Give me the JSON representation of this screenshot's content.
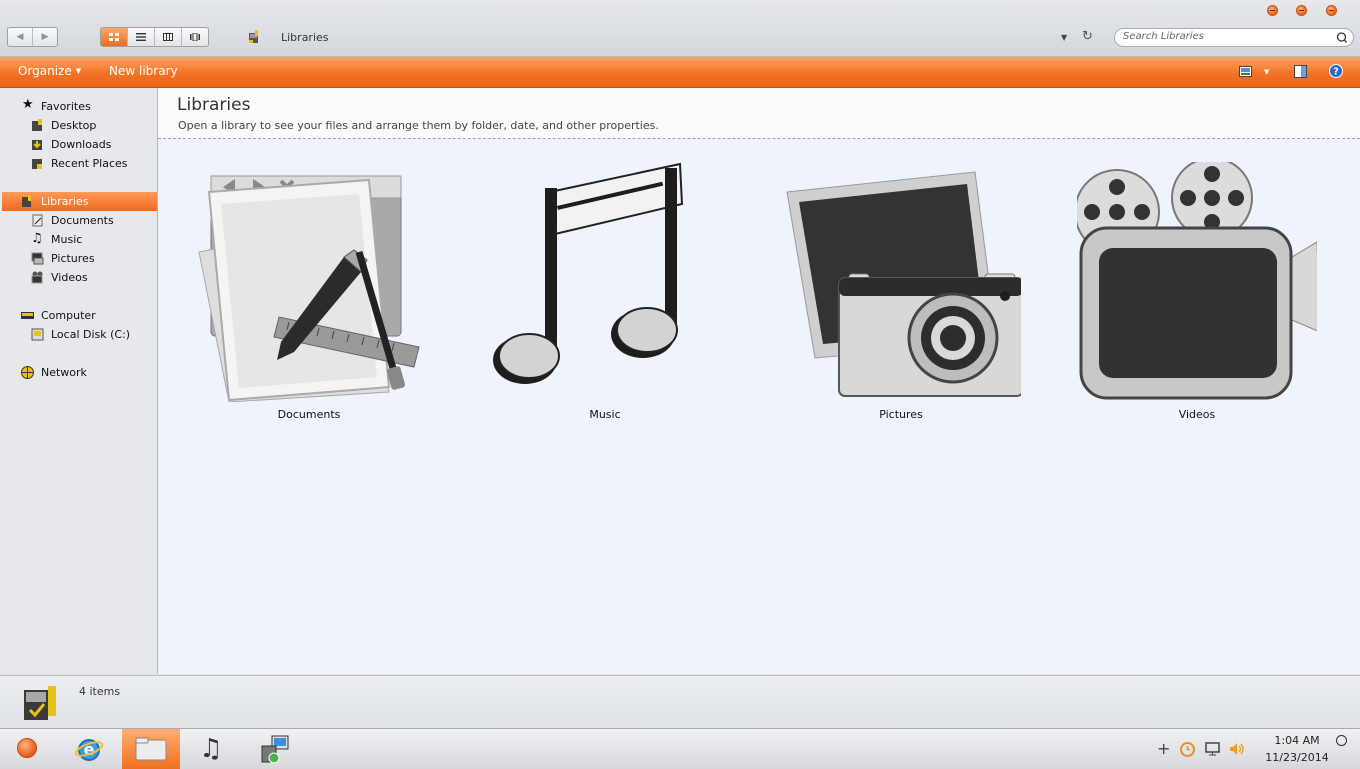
{
  "window": {
    "address_path": "Libraries",
    "search_placeholder": "Search Libraries"
  },
  "toolbar": {
    "organize_label": "Organize",
    "new_library_label": "New library"
  },
  "sidebar": {
    "favorites": {
      "label": "Favorites",
      "items": [
        {
          "label": "Desktop"
        },
        {
          "label": "Downloads"
        },
        {
          "label": "Recent Places"
        }
      ]
    },
    "libraries": {
      "label": "Libraries",
      "items": [
        {
          "label": "Documents"
        },
        {
          "label": "Music"
        },
        {
          "label": "Pictures"
        },
        {
          "label": "Videos"
        }
      ]
    },
    "computer": {
      "label": "Computer",
      "items": [
        {
          "label": "Local Disk (C:)"
        }
      ]
    },
    "network": {
      "label": "Network"
    }
  },
  "content": {
    "title": "Libraries",
    "description": "Open a library to see your files and arrange them by folder, date, and other properties.",
    "libraries": [
      {
        "label": "Documents",
        "icon": "documents-icon"
      },
      {
        "label": "Music",
        "icon": "music-note-icon"
      },
      {
        "label": "Pictures",
        "icon": "camera-photo-icon"
      },
      {
        "label": "Videos",
        "icon": "film-camera-icon"
      }
    ]
  },
  "details": {
    "item_count": "4 items"
  },
  "taskbar": {
    "clock_time": "1:04 AM",
    "clock_date": "11/23/2014"
  },
  "colors": {
    "accent": "#f27326",
    "selection": "#ef6a1d"
  }
}
